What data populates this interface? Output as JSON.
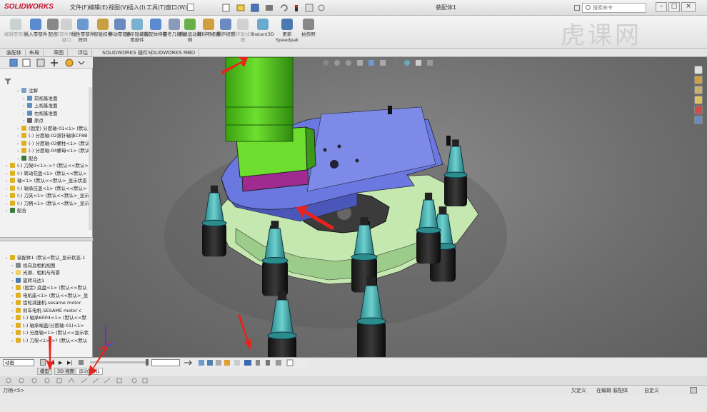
{
  "app": {
    "logo_text": "SOLIDWORKS",
    "document_title": "装配体1",
    "search_placeholder": "搜索命令",
    "menus": [
      "文件(F)",
      "编辑(E)",
      "视图(V)",
      "插入(I)",
      "工具(T)",
      "窗口(W)"
    ],
    "watermark": "虎课网"
  },
  "ribbon": {
    "buttons": [
      {
        "label": "编辑零部件",
        "dim": true
      },
      {
        "label": "插入零部件",
        "dim": false
      },
      {
        "label": "配合",
        "dim": false
      },
      {
        "label": "零部件预览窗口",
        "dim": true
      },
      {
        "label": "线性零部件阵列",
        "dim": false
      },
      {
        "label": "智能扣件",
        "dim": false
      },
      {
        "label": "移动零部件",
        "dim": false
      },
      {
        "label": "显示隐藏的零部件",
        "dim": false
      },
      {
        "label": "装配体特征",
        "dim": false
      },
      {
        "label": "参考几何体",
        "dim": false
      },
      {
        "label": "新建运动算例",
        "dim": false
      },
      {
        "label": "材料明细表",
        "dim": false
      },
      {
        "label": "爆炸视图",
        "dim": false
      },
      {
        "label": "爆炸直线草图",
        "dim": true
      },
      {
        "label": "Instant3D",
        "dim": false
      },
      {
        "label": "更新Speedpak",
        "dim": false
      },
      {
        "label": "拍快照",
        "dim": false
      }
    ]
  },
  "command_tabs": [
    "装配体",
    "布局",
    "草图",
    "评估",
    "SOLIDWORKS 插件",
    "SOLIDWORKS MBD"
  ],
  "feature_tree": {
    "items": [
      {
        "label": "注解",
        "indent": 2,
        "color": "#7aa0c8"
      },
      {
        "label": "前视基准面",
        "indent": 3,
        "color": "#5f8fc0"
      },
      {
        "label": "上视基准面",
        "indent": 3,
        "color": "#5f8fc0"
      },
      {
        "label": "右视基准面",
        "indent": 3,
        "color": "#5f8fc0"
      },
      {
        "label": "原点",
        "indent": 3,
        "color": "#666666"
      },
      {
        "label": "(固定) 分度轴-01<1> (默认<<",
        "indent": 2,
        "color": "#e0b020"
      },
      {
        "label": "(-) 分度轴-02滚针轴承CF8B",
        "indent": 2,
        "color": "#e0b020"
      },
      {
        "label": "(-) 分度轴-03螺柱<1> (默认",
        "indent": 2,
        "color": "#e0b020"
      },
      {
        "label": "(-) 分度轴-04螺母<1> (默认",
        "indent": 2,
        "color": "#e0b020"
      },
      {
        "label": "配合",
        "indent": 2,
        "color": "#3a7a3a"
      },
      {
        "label": "(-) 刀架0<1>->? (默认<<默认>",
        "indent": 0,
        "color": "#e0b020"
      },
      {
        "label": "(-) 转动花盘<1> (默认<<默认>",
        "indent": 0,
        "color": "#e0b020"
      },
      {
        "label": "轴<1> (默认<<默认>_显示状态",
        "indent": 0,
        "color": "#e0b020"
      },
      {
        "label": "(-) 轴承压盖<1> (默认<<默认>",
        "indent": 0,
        "color": "#e0b020"
      },
      {
        "label": "(-) 刀夹<1> (默认<<默认>_显示",
        "indent": 0,
        "color": "#e0b020"
      },
      {
        "label": "(-) 刀柄<1> (默认<<默认>_显示",
        "indent": 0,
        "color": "#e0b020"
      },
      {
        "label": "配合",
        "indent": 0,
        "color": "#3a7a3a"
      }
    ]
  },
  "motion_tree": {
    "items": [
      {
        "label": "装配体1 (默认<默认_显示状态-1",
        "indent": 0,
        "color": "#e0b020"
      },
      {
        "label": "视向及相机视图",
        "indent": 1,
        "color": "#888888"
      },
      {
        "label": "光源、相机与布景",
        "indent": 1,
        "color": "#f0d060"
      },
      {
        "label": "旋转马达1",
        "indent": 1,
        "color": "#4a7ab0"
      },
      {
        "label": "(固定) 底盘<1> (默认<<默认",
        "indent": 1,
        "color": "#e0b020"
      },
      {
        "label": "电机座<1> (默认<<默认>_显",
        "indent": 1,
        "color": "#e0b020"
      },
      {
        "label": "齿轮减速机-sesame motor",
        "indent": 1,
        "color": "#e0b020"
      },
      {
        "label": "刹车电机-SESAME motor c",
        "indent": 1,
        "color": "#e0b020"
      },
      {
        "label": "(-) 轴承6004<1> (默认<<默",
        "indent": 1,
        "color": "#e0b020"
      },
      {
        "label": "(-) 轴承端盖(分度轴-01)<1>",
        "indent": 1,
        "color": "#e0b020"
      },
      {
        "label": "(-) 分度轴<1> (默认<<显示状",
        "indent": 1,
        "color": "#e0b020"
      },
      {
        "label": "(-) 刀架<1>->? (默认<<默认",
        "indent": 1,
        "color": "#e0b020"
      }
    ]
  },
  "motion_controls": {
    "study_type": "动画",
    "bottom_tabs": [
      "模型",
      "3D 视图",
      "运动算例1"
    ]
  },
  "status": {
    "left_text": "刀柄<5>",
    "under_defined": "欠定义",
    "editing": "在编辑 装配体",
    "custom": "自定义"
  },
  "colors": {
    "accent_red": "#c8102e",
    "arrow_red": "#e8231b",
    "green_column": "#58d020",
    "blue_plate": "#6a78e0",
    "teal_holder": "#3aa8a8",
    "pale_green_plate": "#c4e8b0"
  }
}
